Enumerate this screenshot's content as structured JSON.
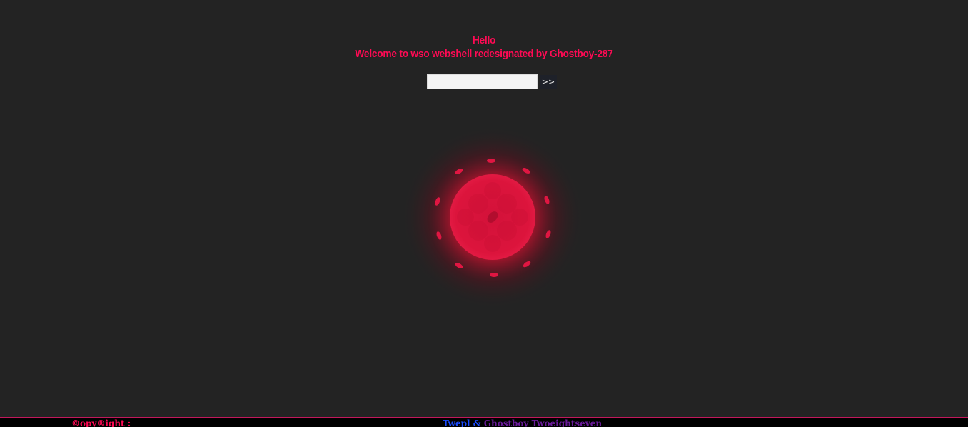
{
  "header": {
    "greeting": "Hello",
    "welcome": "Welcome to wso webshell redesignated by Ghostboy-287"
  },
  "login": {
    "password_value": "",
    "submit_label": ">>"
  },
  "footer": {
    "copyright": "©opy®ight :",
    "credit_twepl": "Twepl",
    "credit_separator": " & ",
    "credit_ghostboy": "Ghostboy Twoeightseven"
  },
  "colors": {
    "background": "#232323",
    "accent": "#ff0a54",
    "orb": "#dc143c",
    "footer_bg": "#000000",
    "link_blue": "#1a4bff",
    "link_purple": "#6a1b9a"
  },
  "icons": {
    "orb": "glowing-red-orb-icon"
  }
}
